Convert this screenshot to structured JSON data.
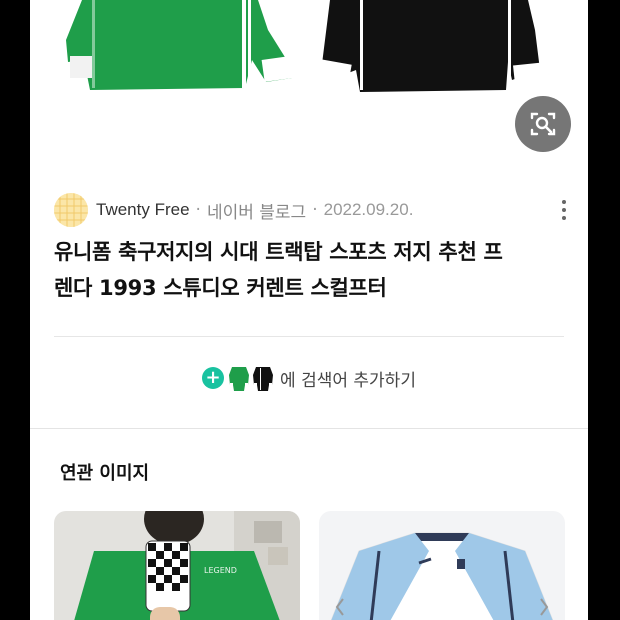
{
  "source": {
    "name": "Twenty Free",
    "site": "네이버 블로그",
    "date": "2022.09.20.",
    "separator": "·"
  },
  "post": {
    "title_line1": "유니폼 축구저지의 시대 트랙탑 스포츠 저지 추천 프",
    "title_line2": "렌다 1993 스튜디오 커렌트 스컬프터"
  },
  "search_add": {
    "label": "에 검색어 추가하기",
    "plus": "+"
  },
  "related": {
    "title": "연관 이미지"
  },
  "colors": {
    "green_jersey": "#1f9e4a",
    "black_jersey": "#111111",
    "accent_teal": "#19c2a0",
    "sky_blue": "#9fc8e8"
  },
  "icons": {
    "lens": "image-search-icon",
    "more": "more-vertical-icon",
    "plus": "plus-icon"
  }
}
